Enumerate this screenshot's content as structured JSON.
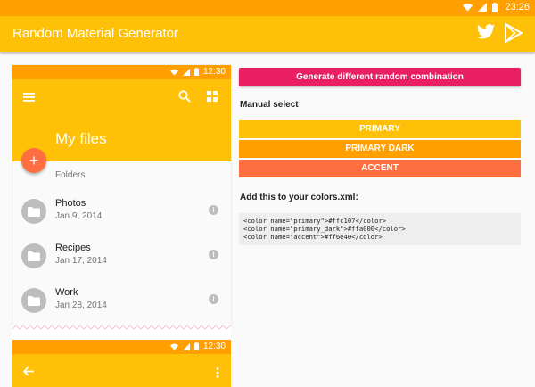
{
  "status_bar": {
    "time": "23:26",
    "icons": [
      "wifi-icon",
      "signal-icon",
      "battery-icon"
    ]
  },
  "app_bar": {
    "title": "Random Material Generator",
    "actions": [
      "twitter-icon",
      "google-play-icon"
    ]
  },
  "phone_preview": {
    "status_time": "12:30",
    "toolbar_icons": [
      "menu-icon",
      "search-icon",
      "grid-view-icon"
    ],
    "title": "My files",
    "fab_label": "+",
    "section_label": "Folders",
    "files": [
      {
        "name": "Photos",
        "date": "Jan 9, 2014"
      },
      {
        "name": "Recipes",
        "date": "Jan 17, 2014"
      },
      {
        "name": "Work",
        "date": "Jan 28, 2014"
      }
    ],
    "info_glyph": "i"
  },
  "phone_preview_2": {
    "status_time": "12:30",
    "toolbar_icons": [
      "back-arrow-icon",
      "more-vert-icon"
    ]
  },
  "panel": {
    "generate_label": "Generate different random combination",
    "manual_label": "Manual select",
    "colors": [
      {
        "label": "PRIMARY",
        "hex": "#ffc107"
      },
      {
        "label": "PRIMARY DARK",
        "hex": "#ffa000"
      },
      {
        "label": "ACCENT",
        "hex": "#ff6e40"
      }
    ],
    "xml_label": "Add this to your colors.xml:",
    "xml_lines": [
      "<color name=\"primary\">#ffc107</color>",
      "<color name=\"primary_dark\">#ffa000</color>",
      "<color name=\"accent\">#ff6e40</color>"
    ]
  },
  "theme": {
    "primary": "#ffc107",
    "primary_dark": "#ffa000",
    "accent": "#ff6e40",
    "button": "#e91e63"
  }
}
